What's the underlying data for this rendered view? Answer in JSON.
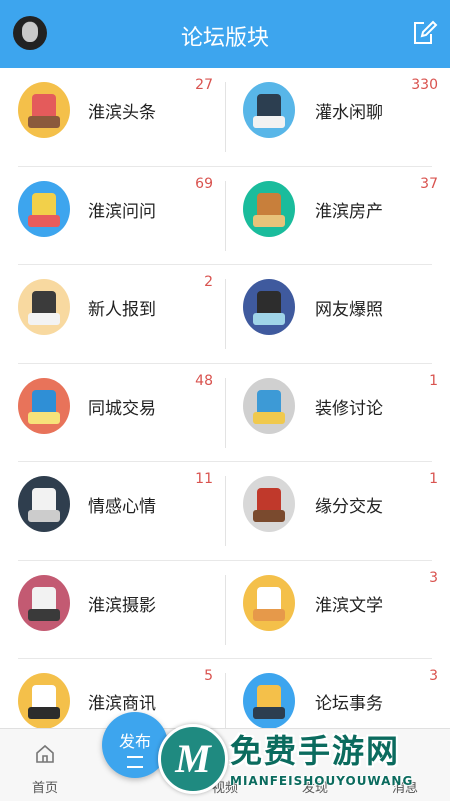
{
  "header": {
    "title": "论坛版块",
    "avatar_icon": "user-avatar",
    "edit_icon": "edit-square-icon"
  },
  "forums": [
    {
      "name": "淮滨头条",
      "count": "27",
      "icon": "reading-person-icon",
      "bg": "#f4c04a",
      "c1": "#e45b5b",
      "c2": "#8b5a3c"
    },
    {
      "name": "灌水闲聊",
      "count": "330",
      "icon": "classroom-icon",
      "bg": "#58b6e8",
      "c1": "#2c3e50",
      "c2": "#f2f2f2"
    },
    {
      "name": "淮滨问问",
      "count": "69",
      "icon": "abc-blocks-icon",
      "bg": "#3da5ee",
      "c1": "#f2d04a",
      "c2": "#e85c5c"
    },
    {
      "name": "淮滨房产",
      "count": "37",
      "icon": "house-icon",
      "bg": "#1abc9c",
      "c1": "#c87f3b",
      "c2": "#e8c37a"
    },
    {
      "name": "新人报到",
      "count": "2",
      "icon": "student-icon",
      "bg": "#f8d9a0",
      "c1": "#3b3b3b",
      "c2": "#f3f3f3"
    },
    {
      "name": "网友爆照",
      "count": "",
      "icon": "girl-avatar-icon",
      "bg": "#3f5a9e",
      "c1": "#2d2d2d",
      "c2": "#9fd4e8"
    },
    {
      "name": "同城交易",
      "count": "48",
      "icon": "drawing-tools-icon",
      "bg": "#e8735a",
      "c1": "#2f8fd6",
      "c2": "#f7e27a"
    },
    {
      "name": "装修讨论",
      "count": "1",
      "icon": "backpack-icon",
      "bg": "#d0d0d0",
      "c1": "#3d9ad6",
      "c2": "#f0c94d"
    },
    {
      "name": "情感心情",
      "count": "11",
      "icon": "document-icon",
      "bg": "#2f3e4e",
      "c1": "#f2f2f2",
      "c2": "#cccccc"
    },
    {
      "name": "缘分交友",
      "count": "1",
      "icon": "girl-reading-icon",
      "bg": "#d8d8d8",
      "c1": "#c0392b",
      "c2": "#7a4a2e"
    },
    {
      "name": "淮滨摄影",
      "count": "",
      "icon": "telescope-icon",
      "bg": "#c35a72",
      "c1": "#f2f2f2",
      "c2": "#3a3a3a"
    },
    {
      "name": "淮滨文学",
      "count": "3",
      "icon": "notes-pencil-icon",
      "bg": "#f4c04a",
      "c1": "#ffffff",
      "c2": "#e6994a"
    },
    {
      "name": "淮滨商讯",
      "count": "5",
      "icon": "shopping-bag-icon",
      "bg": "#f4c04a",
      "c1": "#ffffff",
      "c2": "#2c2c2c"
    },
    {
      "name": "论坛事务",
      "count": "3",
      "icon": "pen-nib-icon",
      "bg": "#3da5ee",
      "c1": "#f4c04a",
      "c2": "#2c3e50"
    }
  ],
  "tabbar": {
    "home": "首页",
    "publish": "发布",
    "video": "视频",
    "discover": "发现",
    "messages": "消息"
  },
  "watermark": {
    "main": "免费手游网",
    "sub": "MIANFEISHOUYOUWANG",
    "logo_letter": "M"
  },
  "colors": {
    "accent": "#3da5ee",
    "count": "#d9534f"
  }
}
